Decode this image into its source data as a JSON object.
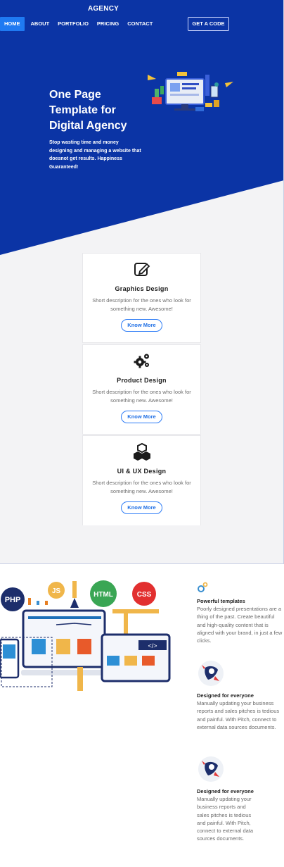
{
  "header": {
    "brand": "AGENCY",
    "nav": [
      {
        "label": "HOME",
        "active": true
      },
      {
        "label": "ABOUT",
        "active": false
      },
      {
        "label": "PORTFOLIO",
        "active": false
      },
      {
        "label": "PRICING",
        "active": false
      },
      {
        "label": "CONTACT",
        "active": false
      }
    ],
    "cta_label": "GET A CODE"
  },
  "hero": {
    "title": "One Page Template for Digital Agency",
    "subtitle": "Stop wasting time and money designing and managing a website that doesnot get results. Happiness Guaranteed!"
  },
  "services": [
    {
      "icon": "edit-icon",
      "title": "Graphics Design",
      "text": "Short description for the ones who look for something new. Awesome!",
      "button": "Know More"
    },
    {
      "icon": "gears-icon",
      "title": "Product Design",
      "text": "Short description for the ones who look for something new. Awesome!",
      "button": "Know More"
    },
    {
      "icon": "cubes-icon",
      "title": "UI & UX Design",
      "text": "Short description for the ones who look for something new. Awesome!",
      "button": "Know More"
    }
  ],
  "features": [
    {
      "icon": "gears-color-icon",
      "title": "Powerful templates",
      "text": "Poorly designed presentations are a thing of the past. Create beautiful and high-quality content that is aligned with your brand, in just a few clicks."
    },
    {
      "icon": "rocket-icon",
      "title": "Designed for everyone",
      "text": "Manually updating your business reports and sales pitches is tedious and painful. With Pitch, connect to external data sources documents."
    },
    {
      "icon": "rocket-icon",
      "title": "Designed for everyone",
      "text": "Manually updating your business reports and sales pitches is tedious and painful. With Pitch, connect to external data sources documents."
    }
  ],
  "illustration_labels": {
    "php": "PHP",
    "js": "JS",
    "html": "HTML",
    "css": "CSS",
    "code": "</>"
  },
  "colors": {
    "hero_bg": "#0b34a5",
    "accent": "#1f7af2",
    "section_bg": "#f3f3f5"
  }
}
